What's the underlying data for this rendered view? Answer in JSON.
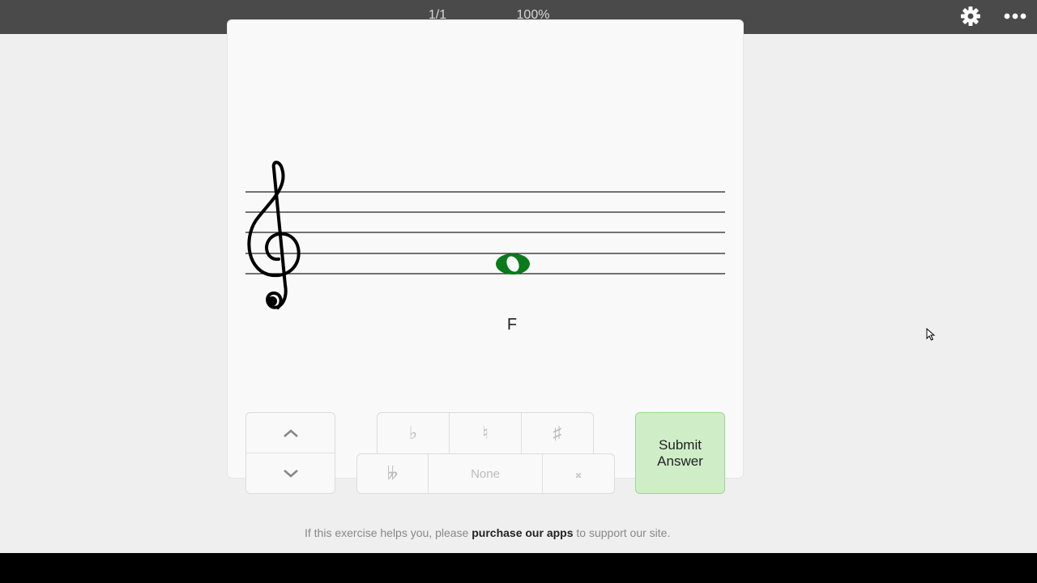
{
  "topbar": {
    "progress": "1/1",
    "zoom": "100%",
    "settings_icon": "gear-icon",
    "more_icon": "ellipsis-icon"
  },
  "exercise": {
    "clef": "treble",
    "note_name": "F",
    "note_color": "#0a7a1a"
  },
  "controls": {
    "up_icon": "chevron-up-icon",
    "down_icon": "chevron-down-icon",
    "flat": "♭",
    "natural": "♮",
    "sharp": "♯",
    "double_flat": "𝄫",
    "none_label": "None",
    "double_sharp": "𝄪",
    "submit_line1": "Submit",
    "submit_line2": "Answer"
  },
  "footer": {
    "prefix": "If this exercise helps you, please ",
    "link": "purchase our apps",
    "suffix": " to support our site."
  },
  "colors": {
    "topbar": "#4a4a4a",
    "submit_bg": "#cfeec8",
    "note": "#0a7a1a"
  }
}
